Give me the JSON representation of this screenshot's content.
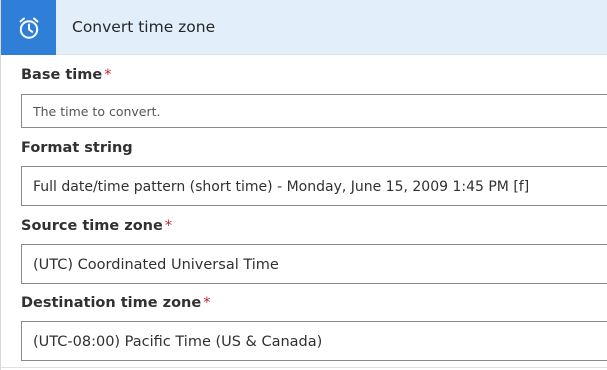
{
  "header": {
    "title": "Convert time zone",
    "icon": "alarm-clock-icon",
    "accent_color": "#2f7fd8"
  },
  "fields": {
    "base_time": {
      "label": "Base time",
      "required_mark": "*",
      "placeholder": "The time to convert."
    },
    "format_string": {
      "label": "Format string",
      "value": "Full date/time pattern (short time) - Monday, June 15, 2009 1:45 PM [f]"
    },
    "source_time_zone": {
      "label": "Source time zone",
      "required_mark": "*",
      "value": "(UTC) Coordinated Universal Time"
    },
    "destination_time_zone": {
      "label": "Destination time zone",
      "required_mark": "*",
      "value": "(UTC-08:00) Pacific Time (US & Canada)"
    }
  }
}
